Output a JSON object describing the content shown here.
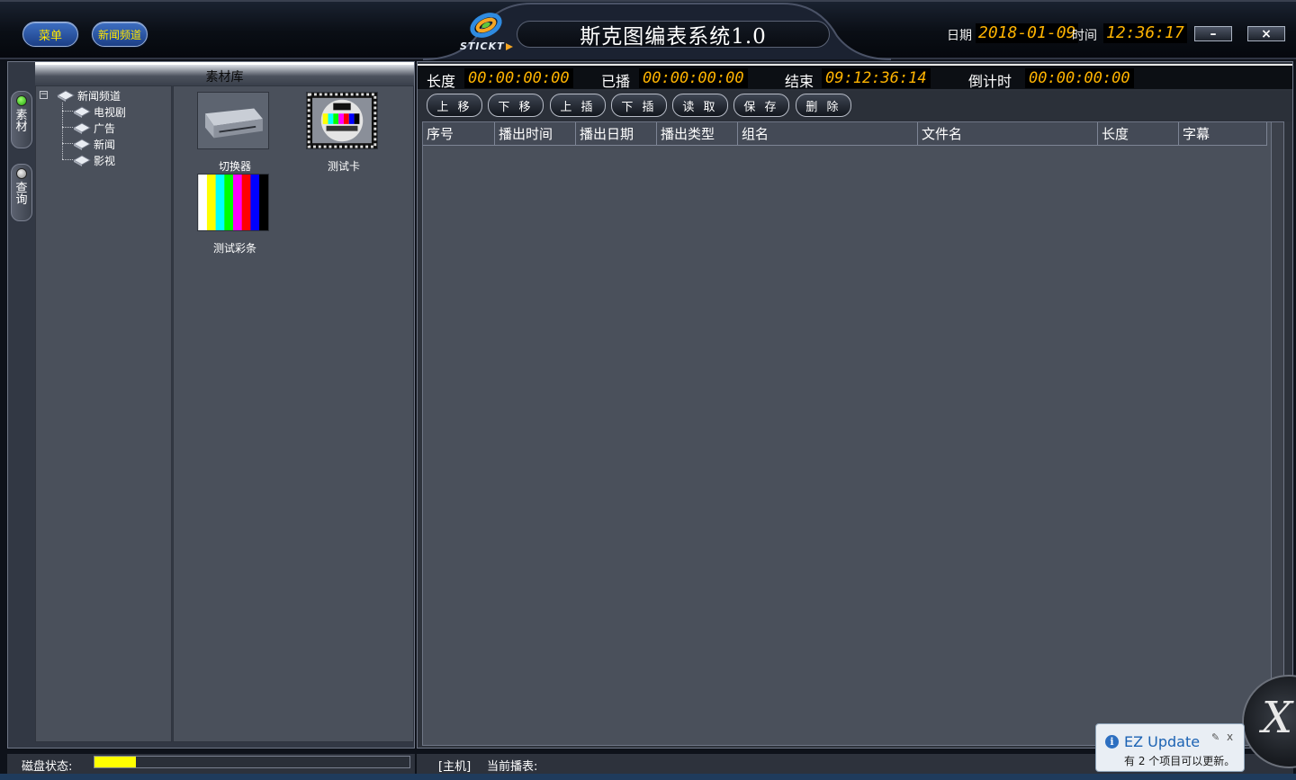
{
  "app": {
    "menu_label": "菜单",
    "channel_label": "新闻频道",
    "logo_text": "STICKT",
    "title": "斯克图编表系统1.0",
    "date_label": "日期",
    "date_value": "2018-01-09",
    "time_label": "时间",
    "time_value": "12:36:17",
    "minimize_label": "–",
    "close_label": "×"
  },
  "left_panel": {
    "library_title": "素材库",
    "tab_material": "素材",
    "tab_query": "查询",
    "tree": {
      "root": "新闻频道",
      "children": [
        "电视剧",
        "广告",
        "新闻",
        "影视"
      ]
    },
    "thumbnails": [
      {
        "label": "切换器",
        "icon": "switcher-device"
      },
      {
        "label": "测试卡",
        "icon": "test-card"
      },
      {
        "label": "测试彩条",
        "icon": "color-bars"
      }
    ],
    "color_bars": [
      "#ffffff",
      "#ffff00",
      "#00ffff",
      "#00ff00",
      "#ff00ff",
      "#ff0000",
      "#0000ff",
      "#000000"
    ]
  },
  "status_left": {
    "disk_label": "磁盘状态:",
    "disk_fill_fraction": 0.13
  },
  "right_panel": {
    "info": {
      "length_label": "长度",
      "length_value": "00:00:00:00",
      "played_label": "已播",
      "played_value": "00:00:00:00",
      "end_label": "结束",
      "end_value": "09:12:36:14",
      "countdown_label": "倒计时",
      "countdown_value": "00:00:00:00"
    },
    "toolbar": [
      "上 移",
      "下 移",
      "上 插",
      "下 插",
      "读 取",
      "保 存",
      "删 除"
    ],
    "columns": [
      "序号",
      "播出时间",
      "播出日期",
      "播出类型",
      "组名",
      "文件名",
      "长度",
      "字幕"
    ]
  },
  "status_right": {
    "host_label": "[主机]",
    "playlist_label": "当前播表:"
  },
  "notification": {
    "title": "EZ Update",
    "message": "有 2 个项目可以更新。",
    "close_label": "x"
  }
}
